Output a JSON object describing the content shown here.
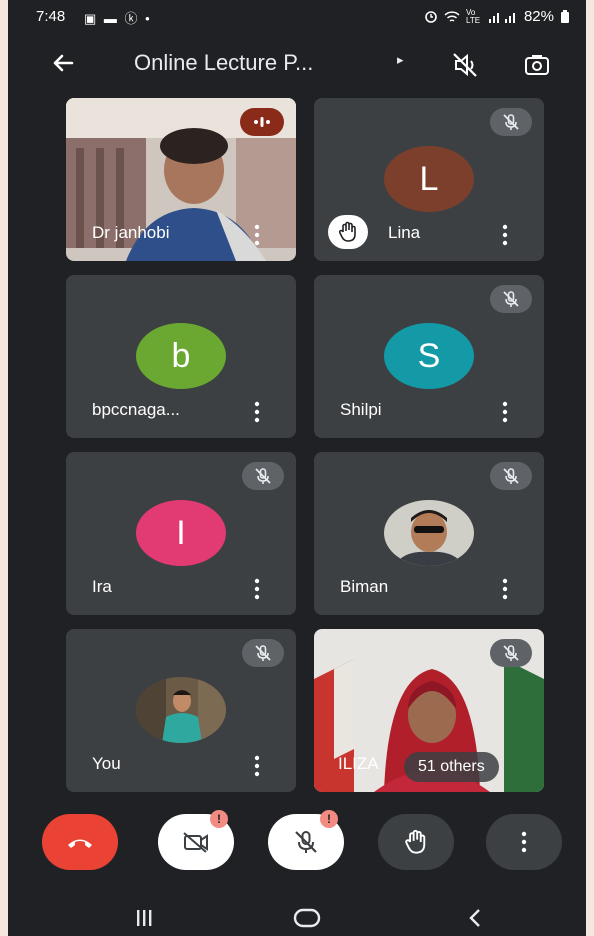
{
  "status_bar": {
    "time": "7:48",
    "notification_icons": [
      "image-icon",
      "video-icon",
      "k-icon"
    ],
    "notif_text": "▣ ▬ ⓚ •",
    "battery": "82%",
    "signal_text": "Vo LTE"
  },
  "header": {
    "title": "Online Lecture P...",
    "caret": "▸"
  },
  "tiles": [
    {
      "name": "Dr janhobi"
    },
    {
      "name": "Lina",
      "initial": "L",
      "avatar_color": "#7b3f2c"
    },
    {
      "name": "bpccnaga...",
      "initial": "b",
      "avatar_color": "#6aa832"
    },
    {
      "name": "Shilpi",
      "initial": "S",
      "avatar_color": "#149aa7"
    },
    {
      "name": "Ira",
      "initial": "I",
      "avatar_color": "#e23a72"
    },
    {
      "name": "Biman"
    },
    {
      "name": "You"
    },
    {
      "name": "ILIZA",
      "others": "51 others"
    }
  ],
  "colors": {
    "background": "#202124",
    "tile": "#3c4043",
    "end_call": "#ea4335",
    "alert": "#f28b82"
  },
  "controls": {
    "cam_alert": "!",
    "mic_alert": "!"
  }
}
